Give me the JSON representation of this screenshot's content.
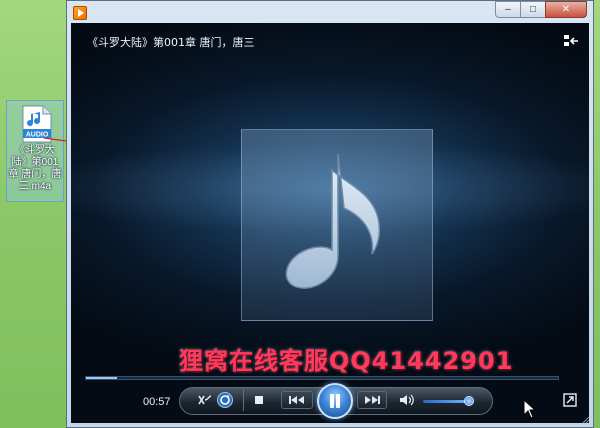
{
  "desktop": {
    "file": {
      "icon_badge": "AUDIO",
      "label": "《斗罗大陆》第001章 唐门，唐三.m4a",
      "icon": "audio-file-icon"
    }
  },
  "window": {
    "app_icon": "media-player-icon",
    "controls": {
      "minimize": "–",
      "maximize": "□",
      "close": "✕"
    }
  },
  "player": {
    "track_title": "《斗罗大陆》第001章 唐门，唐三",
    "watermark": "狸窝在线客服QQ41442901",
    "elapsed": "00:57",
    "progress": 0.065,
    "volume": 0.85,
    "buttons": {
      "shuffle": "shuffle-icon",
      "repeat": "repeat-icon",
      "stop": "stop-icon",
      "previous": "previous-icon",
      "play_pause": "pause-icon",
      "next": "next-icon",
      "mute": "speaker-icon",
      "switch_view": "switch-view-icon",
      "fullscreen": "expand-icon"
    }
  },
  "colors": {
    "accent": "#3f86d8",
    "watermark": "#ff3a5c",
    "desktop": "#8ec86a"
  }
}
